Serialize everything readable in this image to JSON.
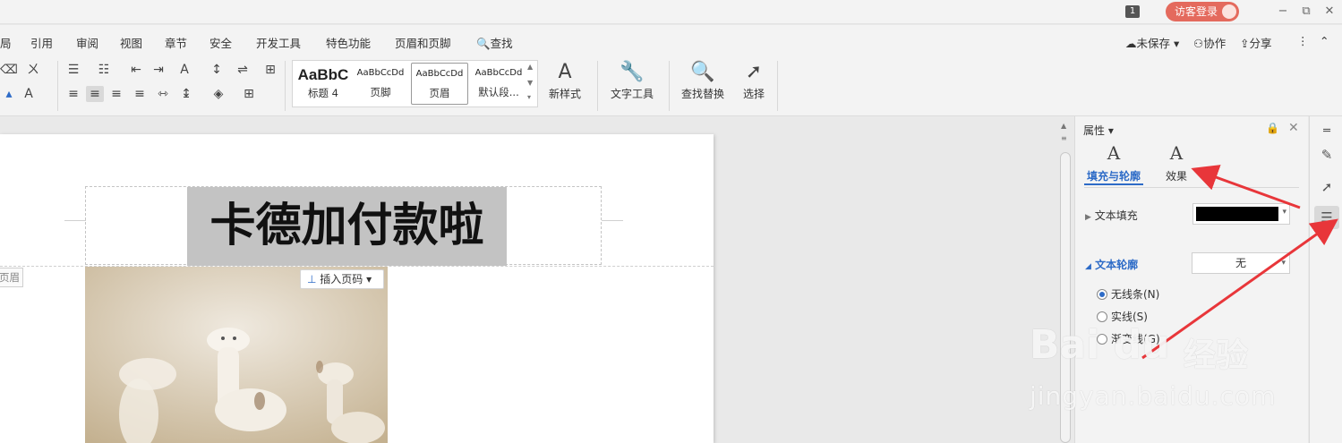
{
  "titlebar": {
    "page_badge": "1",
    "login_label": "访客登录",
    "minimize_glyph": "−",
    "restore_glyph": "⧉",
    "close_glyph": "✕"
  },
  "menu": {
    "items": [
      "局",
      "引用",
      "审阅",
      "视图",
      "章节",
      "安全",
      "开发工具",
      "特色功能",
      "页眉和页脚",
      "查找"
    ],
    "unsaved": "未保存",
    "collab": "协作",
    "share": "分享"
  },
  "ribbon": {
    "styles": [
      {
        "sample": "AaBbC",
        "name": "标题 4"
      },
      {
        "sample": "AaBbCcDd",
        "name": "页脚"
      },
      {
        "sample": "AaBbCcDd",
        "name": "页眉"
      },
      {
        "sample": "AaBbCcDd",
        "name": "默认段..."
      }
    ],
    "new_style": "新样式",
    "text_tool": "文字工具",
    "find_replace": "查找替换",
    "select": "选择"
  },
  "document": {
    "heading": "卡德加付款啦",
    "header_tag": "页眉",
    "insert_page_number": "插入页码"
  },
  "properties": {
    "title": "属性",
    "tabs": [
      {
        "label": "填充与轮廓",
        "active": true
      },
      {
        "label": "效果",
        "active": false
      }
    ],
    "text_fill_label": "文本填充",
    "text_fill_color": "#000000",
    "text_outline_label": "文本轮廓",
    "text_outline_value": "无",
    "radios": [
      {
        "label": "无线条(N)",
        "checked": true
      },
      {
        "label": "实线(S)",
        "checked": false
      },
      {
        "label": "渐变线(G)",
        "checked": false
      }
    ]
  },
  "watermark": {
    "logo": "Bai du",
    "sub": "经验",
    "url": "jingyan.baidu.com"
  },
  "colors": {
    "accent": "#2d6bc7",
    "login_button": "#e46a5d",
    "arrow": "#e8363a"
  }
}
